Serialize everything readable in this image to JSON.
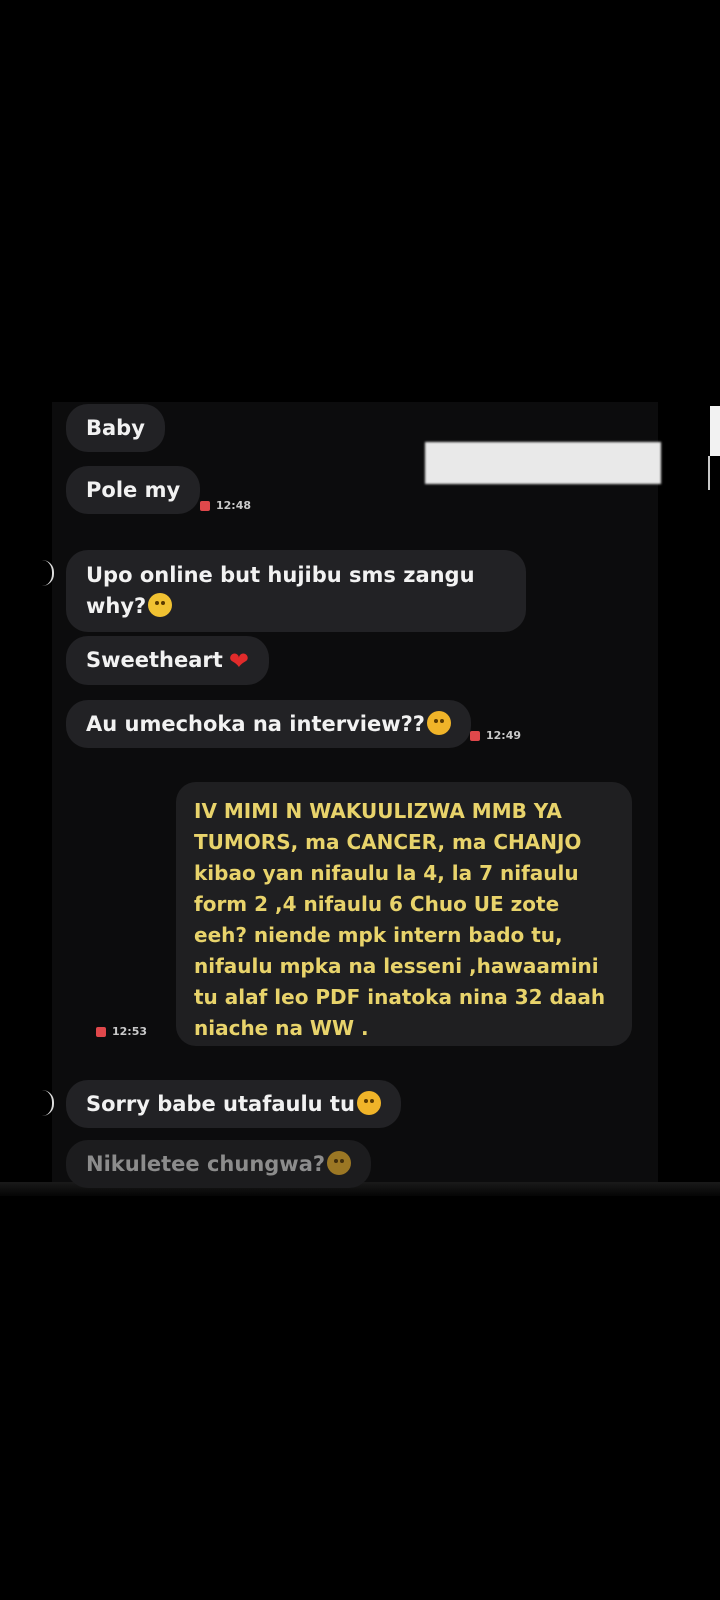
{
  "messages": {
    "m1": "Baby",
    "m2": "Pole my",
    "m2_time": "12:48",
    "m3_line1": "Upo online  but hujibu sms zangu",
    "m3_line2": "why?",
    "m3_emoji": "pensive-face",
    "m4": "Sweetheart",
    "m4_emoji": "red-heart",
    "m5": "Au umechoka na interview??",
    "m5_emoji": "frowning-face",
    "m5_time": "12:49",
    "m6_lines": [
      "IV MIMI N WAKUULIZWA MMB YA",
      "TUMORS, ma CANCER, ma CHANJO",
      "kibao  yan nifaulu la 4, la 7 nifaulu",
      "form 2 ,4 nifaulu 6 Chuo UE zote",
      "eeh? niende mpk intern bado tu,",
      "nifaulu mpka na lesseni ,hawaamini",
      "tu alaf leo PDF inatoka nina 32 daah",
      "niache na WW ."
    ],
    "m6_time": "12:53",
    "m7": "Sorry babe utafaulu tu",
    "m7_emoji": "frowning-face",
    "m8": "Nikuletee chungwa?",
    "m8_emoji": "frowning-face"
  },
  "colors": {
    "background": "#000000",
    "chat_background": "#0c0c0d",
    "bubble_incoming": "#222225",
    "outgoing_text": "#e8d36b",
    "heart": "#e12b2b"
  }
}
